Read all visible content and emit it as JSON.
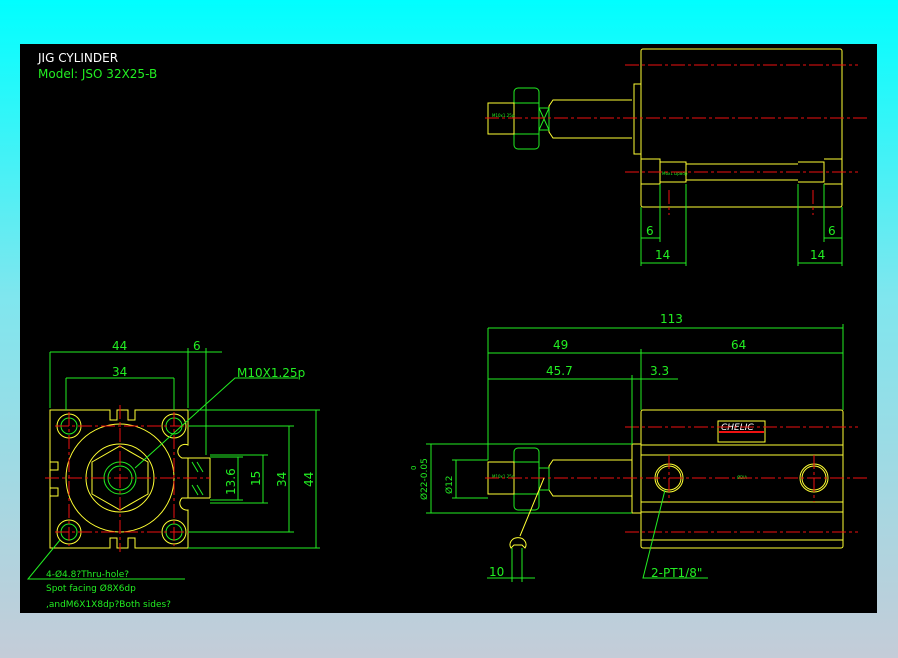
{
  "title": "JIG CYLINDER",
  "model": "Model: JSO 32X25-B",
  "colors": {
    "background_top": "#00ffff",
    "background_bottom": "#c4ccd8",
    "canvas": "#000000",
    "outline": "#ffff33",
    "dimension": "#22ee22",
    "centerline": "#ee1111"
  },
  "front_view": {
    "dims": {
      "width": "44",
      "offset": "6",
      "hole_pitch": "34",
      "port_13_6": "13.6",
      "port_15": "15",
      "v_pitch": "34",
      "height": "44"
    },
    "thread_note": "M10X1.25p",
    "hole_note": [
      "4-Ø4.8?Thru-hole?",
      "Spot facing Ø8X6dp",
      ",andM6X1X8dp?Both sides?"
    ]
  },
  "top_view": {
    "dims": {
      "left_6": "6",
      "left_14": "14",
      "right_6": "6",
      "right_14": "14"
    },
    "rod_text": "M10x1.25p",
    "bar_text": "M6x1 Dp8dp"
  },
  "side_view": {
    "dims": {
      "total": "113",
      "rod_len": "49",
      "body_len": "64",
      "d45_7": "45.7",
      "d3_3": "3.3",
      "d22": "Ø22-0.05",
      "d22_tol": "0",
      "d12": "Ø12",
      "wrench": "10"
    },
    "port_note": "2-PT1/8\"",
    "brand_label": "CHELIC",
    "rod_text": "M10x1.25p",
    "center_text": "ØDIA"
  }
}
